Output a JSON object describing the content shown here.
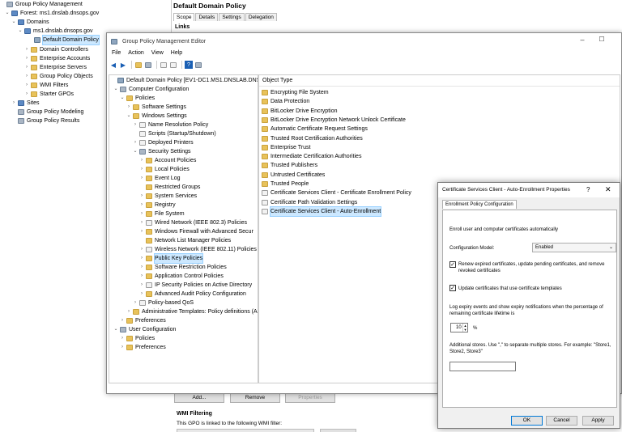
{
  "gpm": {
    "tree": [
      {
        "label": "Group Policy Management",
        "icon": "gpm-icon",
        "toggle": ""
      },
      {
        "label": "Forest: ms1.dnslab.dnsops.gov",
        "icon": "forest-icon",
        "toggle": "v"
      },
      {
        "label": "Domains",
        "icon": "domains-icon",
        "toggle": "v"
      },
      {
        "label": "ms1.dnslab.dnsops.gov",
        "icon": "domain-icon",
        "toggle": "v"
      },
      {
        "label": "Default Domain Policy",
        "icon": "gpo-link-icon",
        "toggle": ""
      },
      {
        "label": "Domain Controllers",
        "icon": "ou-icon",
        "toggle": ">"
      },
      {
        "label": "Enterprise Accounts",
        "icon": "ou-icon",
        "toggle": ">"
      },
      {
        "label": "Enterprise Servers",
        "icon": "ou-icon",
        "toggle": ">"
      },
      {
        "label": "Group Policy Objects",
        "icon": "folder-icon",
        "toggle": ">"
      },
      {
        "label": "WMI Filters",
        "icon": "folder-icon",
        "toggle": ">"
      },
      {
        "label": "Starter GPOs",
        "icon": "folder-icon",
        "toggle": ">"
      },
      {
        "label": "Sites",
        "icon": "sites-icon",
        "toggle": ">"
      },
      {
        "label": "Group Policy Modeling",
        "icon": "modeling-icon",
        "toggle": ""
      },
      {
        "label": "Group Policy Results",
        "icon": "results-icon",
        "toggle": ""
      }
    ]
  },
  "bg_panel": {
    "title": "Default Domain Policy",
    "tabs": [
      "Scope",
      "Details",
      "Settings",
      "Delegation"
    ],
    "links_label": "Links",
    "buttons": [
      "Add...",
      "Remove",
      "Properties"
    ],
    "wmi_title": "WMI Filtering",
    "wmi_text": "This GPO is linked to the following WMI filter:"
  },
  "editor": {
    "title": "Group Policy Management Editor",
    "menu": [
      "File",
      "Action",
      "View",
      "Help"
    ],
    "tree": [
      {
        "label": "Default Domain Policy [EV1-DC1.MS1.DNSLAB.DNSOPS.C",
        "icon": "gpo",
        "toggle": ""
      },
      {
        "label": "Computer Configuration",
        "icon": "cfg",
        "toggle": "v"
      },
      {
        "label": "Policies",
        "icon": "folder",
        "toggle": "v"
      },
      {
        "label": "Software Settings",
        "icon": "folder",
        "toggle": ">"
      },
      {
        "label": "Windows Settings",
        "icon": "folder",
        "toggle": "v"
      },
      {
        "label": "Name Resolution Policy",
        "icon": "doc",
        "toggle": ">"
      },
      {
        "label": "Scripts (Startup/Shutdown)",
        "icon": "doc",
        "toggle": ""
      },
      {
        "label": "Deployed Printers",
        "icon": "doc",
        "toggle": ">"
      },
      {
        "label": "Security Settings",
        "icon": "cfg",
        "toggle": "v"
      },
      {
        "label": "Account Policies",
        "icon": "folder",
        "toggle": ">"
      },
      {
        "label": "Local Policies",
        "icon": "folder",
        "toggle": ">"
      },
      {
        "label": "Event Log",
        "icon": "folder",
        "toggle": ">"
      },
      {
        "label": "Restricted Groups",
        "icon": "folder",
        "toggle": ""
      },
      {
        "label": "System Services",
        "icon": "folder",
        "toggle": ">"
      },
      {
        "label": "Registry",
        "icon": "folder",
        "toggle": ">"
      },
      {
        "label": "File System",
        "icon": "folder",
        "toggle": ">"
      },
      {
        "label": "Wired Network (IEEE 802.3) Policies",
        "icon": "doc",
        "toggle": ">"
      },
      {
        "label": "Windows Firewall with Advanced Secur",
        "icon": "folder",
        "toggle": ">"
      },
      {
        "label": "Network List Manager Policies",
        "icon": "folder",
        "toggle": ""
      },
      {
        "label": "Wireless Network (IEEE 802.11) Policies",
        "icon": "doc",
        "toggle": ">"
      },
      {
        "label": "Public Key Policies",
        "icon": "folder",
        "toggle": ">",
        "selected": true
      },
      {
        "label": "Software Restriction Policies",
        "icon": "folder",
        "toggle": ">"
      },
      {
        "label": "Application Control Policies",
        "icon": "folder",
        "toggle": ">"
      },
      {
        "label": "IP Security Policies on Active Directory",
        "icon": "doc",
        "toggle": ">"
      },
      {
        "label": "Advanced Audit Policy Configuration",
        "icon": "folder",
        "toggle": ">"
      },
      {
        "label": "Policy-based QoS",
        "icon": "doc",
        "toggle": ">"
      },
      {
        "label": "Administrative Templates: Policy definitions (A",
        "icon": "folder",
        "toggle": ">"
      },
      {
        "label": "Preferences",
        "icon": "folder",
        "toggle": ">"
      },
      {
        "label": "User Configuration",
        "icon": "cfg",
        "toggle": "v"
      },
      {
        "label": "Policies",
        "icon": "folder",
        "toggle": ">"
      },
      {
        "label": "Preferences",
        "icon": "folder",
        "toggle": ">"
      }
    ],
    "list_header": "Object Type",
    "list": [
      {
        "label": "Encrypting File System",
        "icon": "folder"
      },
      {
        "label": "Data Protection",
        "icon": "folder"
      },
      {
        "label": "BitLocker Drive Encryption",
        "icon": "folder"
      },
      {
        "label": "BitLocker Drive Encryption Network Unlock Certificate",
        "icon": "folder"
      },
      {
        "label": "Automatic Certificate Request Settings",
        "icon": "folder"
      },
      {
        "label": "Trusted Root Certification Authorities",
        "icon": "folder"
      },
      {
        "label": "Enterprise Trust",
        "icon": "folder"
      },
      {
        "label": "Intermediate Certification Authorities",
        "icon": "folder"
      },
      {
        "label": "Trusted Publishers",
        "icon": "folder"
      },
      {
        "label": "Untrusted Certificates",
        "icon": "folder"
      },
      {
        "label": "Trusted People",
        "icon": "folder"
      },
      {
        "label": "Certificate Services Client - Certificate Enrollment Policy",
        "icon": "doc"
      },
      {
        "label": "Certificate Path Validation Settings",
        "icon": "doc"
      },
      {
        "label": "Certificate Services Client - Auto-Enrollment",
        "icon": "doc",
        "selected": true
      }
    ]
  },
  "dialog": {
    "title": "Certificate Services Client - Auto-Enrollment Properties",
    "help": "?",
    "close": "✕",
    "tab": "Enrollment Policy Configuration",
    "intro": "Enroll user and computer certificates automatically",
    "config_model_label": "Configuration Model:",
    "config_model_value": "Enabled",
    "renew_label": "Renew expired certificates, update pending certificates, and remove revoked certificates",
    "renew_checked": true,
    "update_label": "Update certificates that use certificate templates",
    "update_checked": true,
    "expiry_text": "Log expiry events and show expiry notifications when the percentage of remaining certificate lifetime is",
    "expiry_value": "10",
    "percent": "%",
    "stores_text": "Additional stores. Use \",\" to separate multiple stores. For example: \"Store1, Store2, Store3\"",
    "stores_value": "",
    "buttons": {
      "ok": "OK",
      "cancel": "Cancel",
      "apply": "Apply"
    }
  },
  "colors": {
    "folder": "#e8c25a",
    "selection": "#cce8ff",
    "accent": "#0078d7"
  }
}
